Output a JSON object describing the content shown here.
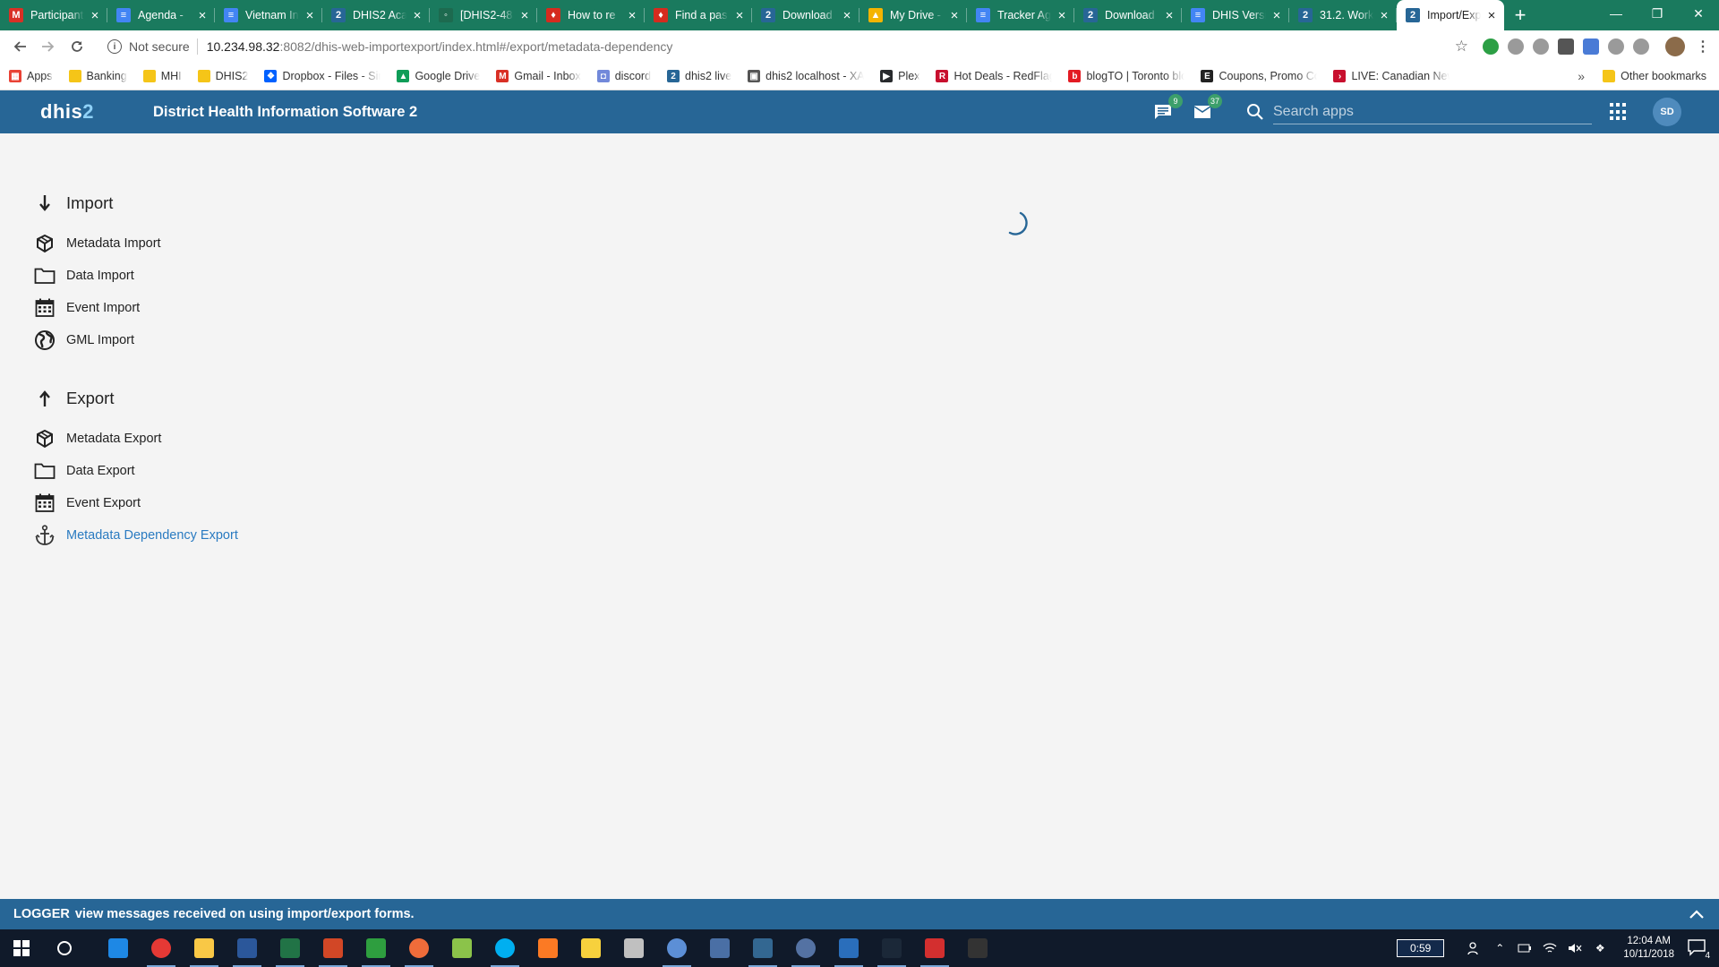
{
  "browser": {
    "tabs": [
      {
        "title": "Participant",
        "favicon": "gmail-icon",
        "color": "#d93025",
        "glyph": "M"
      },
      {
        "title": "Agenda - ",
        "favicon": "docs-icon",
        "color": "#4285f4",
        "glyph": "≡"
      },
      {
        "title": "Vietnam In",
        "favicon": "docs-icon",
        "color": "#4285f4",
        "glyph": "≡"
      },
      {
        "title": "DHIS2 Aca",
        "favicon": "dhis2-icon",
        "color": "#276696",
        "glyph": "2"
      },
      {
        "title": "[DHIS2-48",
        "favicon": "jira-icon",
        "color": "#1d6a4f",
        "glyph": "◦"
      },
      {
        "title": "How to re",
        "favicon": "canada-icon",
        "color": "#d52b1e",
        "glyph": "♦"
      },
      {
        "title": "Find a pas",
        "favicon": "canada-icon",
        "color": "#d52b1e",
        "glyph": "♦"
      },
      {
        "title": "Download",
        "favicon": "dhis2-icon",
        "color": "#276696",
        "glyph": "2"
      },
      {
        "title": "My Drive -",
        "favicon": "drive-icon",
        "color": "#f4b400",
        "glyph": "▲"
      },
      {
        "title": "Tracker Ag",
        "favicon": "docs-icon",
        "color": "#4285f4",
        "glyph": "≡"
      },
      {
        "title": "Download",
        "favicon": "dhis2-icon",
        "color": "#276696",
        "glyph": "2"
      },
      {
        "title": "DHIS Versi",
        "favicon": "docs-icon",
        "color": "#4285f4",
        "glyph": "≡"
      },
      {
        "title": "31.2. Work",
        "favicon": "dhis2-icon",
        "color": "#276696",
        "glyph": "2"
      },
      {
        "title": "Import/Exp",
        "favicon": "dhis2-icon",
        "color": "#276696",
        "glyph": "2",
        "active": true
      }
    ],
    "new_tab": "+",
    "window_controls": {
      "minimize": "—",
      "restore": "❐",
      "close": "✕"
    },
    "address": {
      "security": "Not secure",
      "host": "10.234.98.32",
      "path": ":8082/dhis-web-importexport/index.html#/export/metadata-dependency"
    },
    "bookmarks": [
      {
        "label": "Apps",
        "icon": "apps-grid-icon",
        "color": "#e94235",
        "glyph": "▦"
      },
      {
        "label": "Banking",
        "icon": "folder-icon",
        "folder": true
      },
      {
        "label": "MHI",
        "icon": "folder-icon",
        "folder": true
      },
      {
        "label": "DHIS2",
        "icon": "folder-icon",
        "folder": true
      },
      {
        "label": "Dropbox - Files - Sim",
        "icon": "dropbox-icon",
        "color": "#0061ff",
        "glyph": "❖"
      },
      {
        "label": "Google Drive",
        "icon": "drive-icon",
        "color": "#0f9d58",
        "glyph": "▲"
      },
      {
        "label": "Gmail - Inbox",
        "icon": "gmail-icon",
        "color": "#d93025",
        "glyph": "M"
      },
      {
        "label": "discord",
        "icon": "discord-icon",
        "color": "#7289da",
        "glyph": "◘"
      },
      {
        "label": "dhis2 live",
        "icon": "dhis2-icon",
        "color": "#276696",
        "glyph": "2"
      },
      {
        "label": "dhis2 localhost - XAI",
        "icon": "xampp-icon",
        "color": "#555555",
        "glyph": "▣"
      },
      {
        "label": "Plex",
        "icon": "plex-icon",
        "color": "#282a2d",
        "glyph": "▶"
      },
      {
        "label": "Hot Deals - RedFlagD",
        "icon": "redflag-icon",
        "color": "#c8102e",
        "glyph": "R"
      },
      {
        "label": "blogTO | Toronto blo",
        "icon": "blogto-icon",
        "color": "#e31b23",
        "glyph": "b"
      },
      {
        "label": "Coupons, Promo Cod",
        "icon": "coupon-icon",
        "color": "#222222",
        "glyph": "E"
      },
      {
        "label": "LIVE: Canadian News",
        "icon": "news-icon",
        "color": "#c8102e",
        "glyph": "›"
      }
    ],
    "bookmarks_more": "»",
    "other_bookmarks": "Other bookmarks"
  },
  "header": {
    "logo_text": "dhis",
    "logo_num": "2",
    "title": "District Health Information Software 2",
    "interpretations_count": "9",
    "messages_count": "37",
    "search_placeholder": "Search apps",
    "avatar_initials": "SD"
  },
  "sidebar": {
    "import": {
      "heading": "Import",
      "items": [
        {
          "label": "Metadata Import",
          "icon": "metadata-box-icon"
        },
        {
          "label": "Data Import",
          "icon": "folder-outline-icon"
        },
        {
          "label": "Event Import",
          "icon": "calendar-icon"
        },
        {
          "label": "GML Import",
          "icon": "globe-icon"
        }
      ]
    },
    "export": {
      "heading": "Export",
      "items": [
        {
          "label": "Metadata Export",
          "icon": "metadata-box-icon"
        },
        {
          "label": "Data Export",
          "icon": "folder-outline-icon"
        },
        {
          "label": "Event Export",
          "icon": "calendar-icon"
        },
        {
          "label": "Metadata Dependency Export",
          "icon": "anchor-icon",
          "active": true
        }
      ]
    },
    "active_color": "#2a7bc1"
  },
  "logger": {
    "label": "LOGGER",
    "message": "view messages received on using import/export forms."
  },
  "taskbar": {
    "timer": "0:59",
    "time": "12:04 AM",
    "date": "10/11/2018",
    "notification_count": "4"
  },
  "colors": {
    "app_header": "#276696",
    "tab_strip": "#1a7a5e",
    "taskbar": "#101a2a"
  }
}
